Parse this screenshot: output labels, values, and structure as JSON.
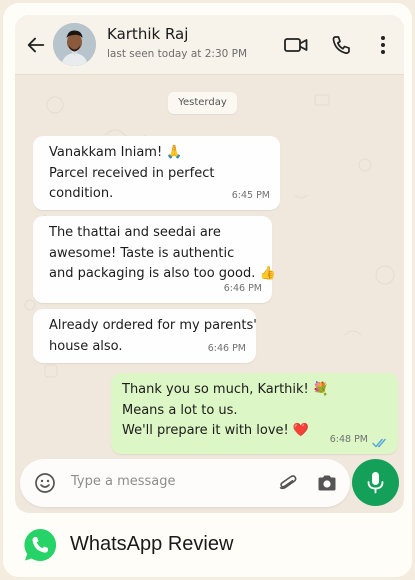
{
  "contact": {
    "name": "Karthik Raj",
    "status": "last seen today at 2:30 PM"
  },
  "day_label": "Yesterday",
  "messages": [
    {
      "direction": "incoming",
      "lines": [
        "Vanakkam Iniam! 🙏",
        "Parcel received in perfect",
        "condition."
      ],
      "time": "6:45 PM"
    },
    {
      "direction": "incoming",
      "lines": [
        "The thattai and seedai are",
        "awesome! Taste is authentic",
        "and packaging is also too good. 👍"
      ],
      "time": "6:46 PM"
    },
    {
      "direction": "incoming",
      "lines": [
        "Already ordered for my parents'",
        "house also."
      ],
      "time": "6:46 PM"
    },
    {
      "direction": "outgoing",
      "lines": [
        "Thank you so much, Karthik! 💐",
        "Means a lot to us.",
        "We'll prepare it with love! ❤️"
      ],
      "time": "6:48 PM",
      "read": true
    }
  ],
  "composer": {
    "placeholder": "Type a message"
  },
  "footer": {
    "title": "WhatsApp Review"
  },
  "icons": {
    "back": "arrow-left-icon",
    "video": "video-call-icon",
    "call": "phone-icon",
    "menu": "more-vertical-icon",
    "emoji": "emoji-icon",
    "attach": "paperclip-icon",
    "camera": "camera-icon",
    "mic": "microphone-icon",
    "read_ticks": "double-check-icon",
    "brand": "whatsapp-logo-icon"
  },
  "colors": {
    "outgoing_bubble": "#dcf6c5",
    "incoming_bubble": "#fefefe",
    "mic_button": "#15a059",
    "read_ticks": "#53a6d8",
    "brand": "#25d366"
  }
}
